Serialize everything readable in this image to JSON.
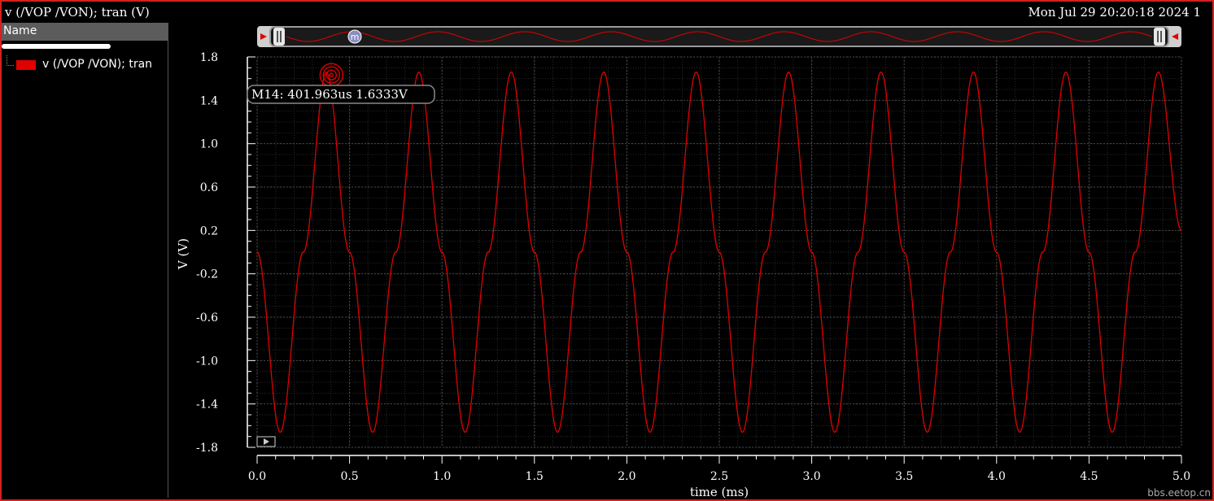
{
  "window": {
    "title": "v (/VOP /VON); tran (V)",
    "timestamp": "Mon Jul 29 20:20:18 2024   1"
  },
  "legend": {
    "header": "Name",
    "entries": [
      {
        "label": "v (/VOP /VON); tran",
        "color": "#e00000"
      }
    ]
  },
  "marker": {
    "name": "M14",
    "label": "M14: 401.963us 1.6333V",
    "badge": "m",
    "x_ms": 0.401963,
    "y_v": 1.6333
  },
  "watermark": "bbs.eetop.cn",
  "colors": {
    "trace": "#e00000",
    "background": "#000000",
    "grid": "#3a3a3a",
    "axis": "#ffffff",
    "frame": "#d42020"
  },
  "chart_data": {
    "type": "line",
    "title": "",
    "xlabel": "time (ms)",
    "ylabel": "V (V)",
    "xlim": [
      0.0,
      5.0
    ],
    "ylim": [
      -1.8,
      1.8
    ],
    "x_ticks": [
      "0.0",
      "0.5",
      "1.0",
      "1.5",
      "2.0",
      "2.5",
      "3.0",
      "3.5",
      "4.0",
      "4.5",
      "5.0"
    ],
    "y_ticks": [
      "1.8",
      "1.4",
      "1.0",
      "0.6",
      "0.2",
      "-0.2",
      "-0.6",
      "-1.0",
      "-1.4",
      "-1.8"
    ],
    "grid": true,
    "series": [
      {
        "name": "v (/VOP /VON); tran",
        "color": "#e00000",
        "x": [
          0.0,
          0.125,
          0.25,
          0.375,
          0.5,
          0.625,
          0.75,
          0.875,
          1.0,
          1.125,
          1.25,
          1.375,
          1.5,
          1.625,
          1.75,
          1.875,
          2.0,
          2.125,
          2.25,
          2.375,
          2.5,
          2.625,
          2.75,
          2.875,
          3.0,
          3.125,
          3.25,
          3.375,
          3.5,
          3.625,
          3.75,
          3.875,
          4.0,
          4.125,
          4.25,
          4.375,
          4.5,
          4.625,
          4.75,
          4.875,
          5.0
        ],
        "y": [
          0.0,
          -1.66,
          0.0,
          1.66,
          0.0,
          -1.66,
          0.0,
          1.66,
          0.0,
          -1.66,
          0.0,
          1.66,
          0.0,
          -1.66,
          0.0,
          1.66,
          0.0,
          -1.66,
          0.0,
          1.66,
          0.0,
          -1.66,
          0.0,
          1.66,
          0.0,
          -1.66,
          0.0,
          1.66,
          0.0,
          -1.66,
          0.0,
          1.66,
          0.0,
          -1.66,
          0.0,
          1.66,
          0.0,
          -1.66,
          0.0,
          1.66,
          0.2
        ]
      }
    ]
  }
}
